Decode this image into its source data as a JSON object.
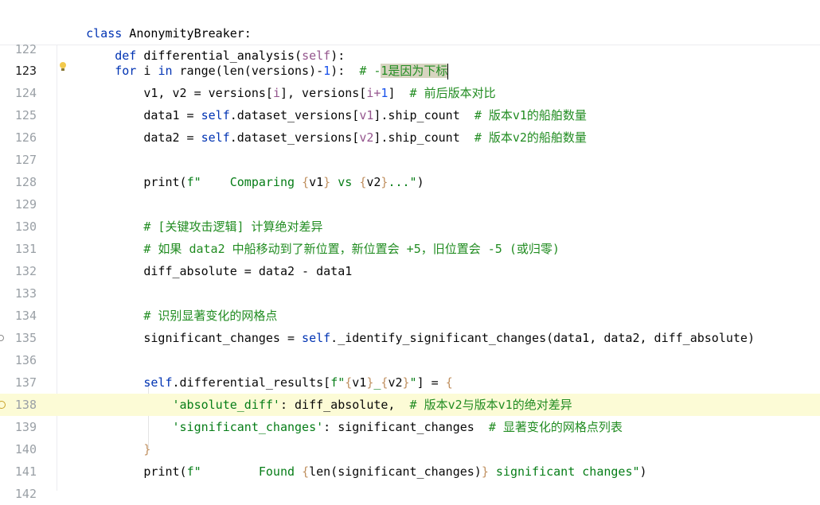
{
  "sticky": {
    "class_line": "class AnonymityBreaker:",
    "def_line": "    def differential_analysis(self):"
  },
  "lines": [
    {
      "num": "122"
    },
    {
      "num": "123"
    },
    {
      "num": "124"
    },
    {
      "num": "125"
    },
    {
      "num": "126"
    },
    {
      "num": "127"
    },
    {
      "num": "128"
    },
    {
      "num": "129"
    },
    {
      "num": "130"
    },
    {
      "num": "131"
    },
    {
      "num": "132"
    },
    {
      "num": "133"
    },
    {
      "num": "134"
    },
    {
      "num": "135"
    },
    {
      "num": "136"
    },
    {
      "num": "137"
    },
    {
      "num": "138"
    },
    {
      "num": "139"
    },
    {
      "num": "140"
    },
    {
      "num": "141"
    },
    {
      "num": "142"
    }
  ],
  "code": {
    "l123_indent": "        ",
    "l123_for": "for",
    "l123_a": " i ",
    "l123_in": "in",
    "l123_b": " range(len(versions)-",
    "l123_num": "1",
    "l123_c": "):  ",
    "l123_cm1": "# -",
    "l123_cm2": "1是因为下标",
    "l124_a": "            v1, v2 = versions[",
    "l124_b": "i",
    "l124_c": "], versions[",
    "l124_d": "i+",
    "l124_e": "1",
    "l124_f": "]  ",
    "l124_cm": "# 前后版本对比",
    "l125_a": "            data1 = ",
    "l125_self": "self",
    "l125_b": ".dataset_versions[",
    "l125_c": "v1",
    "l125_d": "].ship_count  ",
    "l125_cm": "# 版本v1的船舶数量",
    "l126_a": "            data2 = ",
    "l126_self": "self",
    "l126_b": ".dataset_versions[",
    "l126_c": "v2",
    "l126_d": "].ship_count  ",
    "l126_cm": "# 版本v2的船舶数量",
    "l128_a": "            print(",
    "l128_f": "f\"    Comparing ",
    "l128_b1": "{",
    "l128_v1": "v1",
    "l128_b2": "}",
    "l128_vs": " vs ",
    "l128_b3": "{",
    "l128_v2": "v2",
    "l128_b4": "}",
    "l128_end": "...\"",
    "l128_close": ")",
    "l130_cm": "            # [关键攻击逻辑] 计算绝对差异",
    "l131_cm": "            # 如果 data2 中船移动到了新位置，新位置会 +5，旧位置会 -5 (或归零)",
    "l132": "            diff_absolute = data2 - data1",
    "l134_cm": "            # 识别显著变化的网格点",
    "l135_a": "            significant_changes = ",
    "l135_self": "self",
    "l135_b": "._identify_significant_changes(data1, data2, diff_absolute)",
    "l137_a": "            ",
    "l137_self": "self",
    "l137_b": ".differential_results[",
    "l137_f": "f\"",
    "l137_b1": "{",
    "l137_v1": "v1",
    "l137_b2": "}",
    "l137_us": "_",
    "l137_b3": "{",
    "l137_v2": "v2",
    "l137_b4": "}",
    "l137_fe": "\"",
    "l137_c": "] = ",
    "l137_brace": "{",
    "l138_a": "                ",
    "l138_key": "'absolute_diff'",
    "l138_b": ": diff_absolute,  ",
    "l138_cm": "# 版本v2与版本v1的绝对差异",
    "l139_a": "                ",
    "l139_key": "'significant_changes'",
    "l139_b": ": significant_changes  ",
    "l139_cm": "# 显著变化的网格点列表",
    "l140_a": "            ",
    "l140_brace": "}",
    "l141_a": "            print(",
    "l141_f": "f\"        Found ",
    "l141_b1": "{",
    "l141_expr": "len(significant_changes)",
    "l141_b2": "}",
    "l141_end": " significant changes\"",
    "l141_close": ")"
  }
}
